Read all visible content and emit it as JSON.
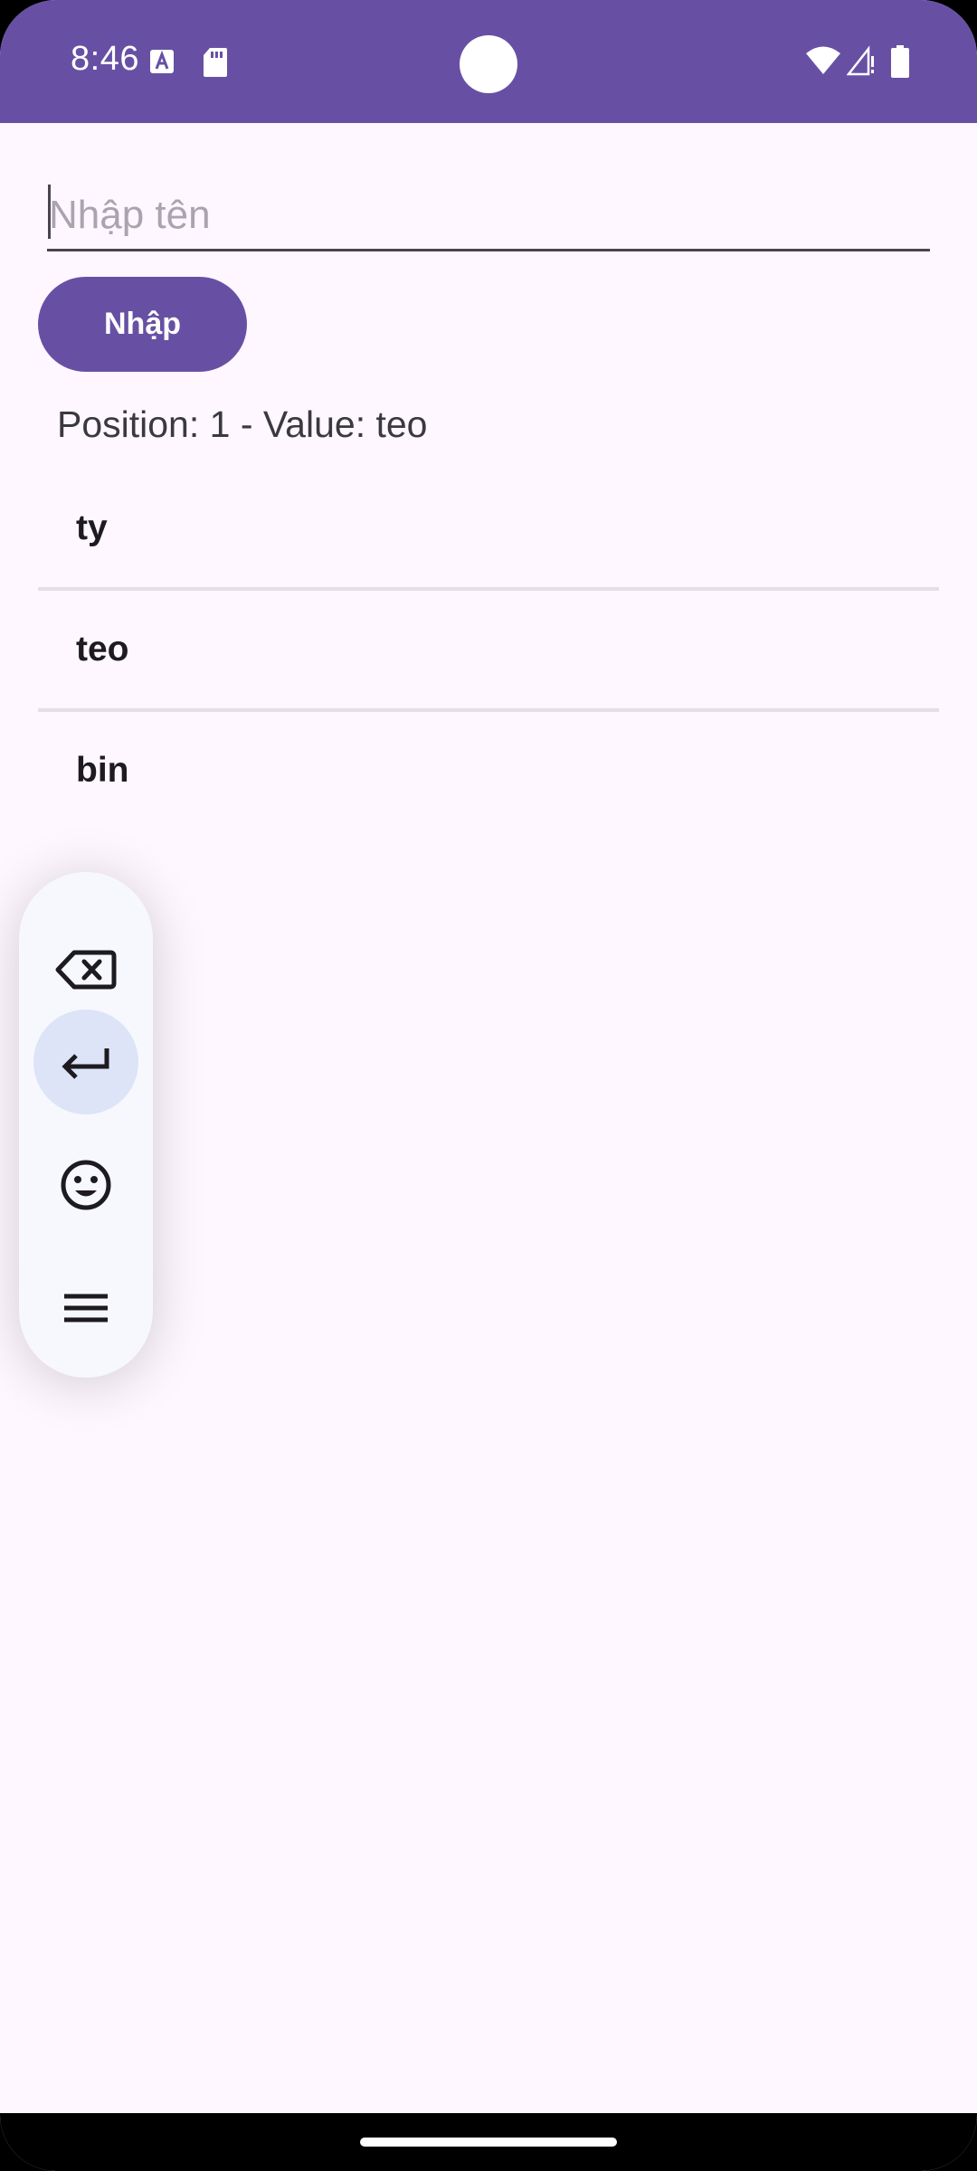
{
  "status_bar": {
    "time": "8:46",
    "icons": [
      "font-a-icon",
      "sd-card-icon",
      "wifi-icon",
      "signal-icon",
      "battery-icon"
    ]
  },
  "form": {
    "input_placeholder": "Nhập tên",
    "input_value": "",
    "submit_label": "Nhập"
  },
  "result": {
    "text": "Position: 1 - Value: teo"
  },
  "list": {
    "items": [
      {
        "label": "ty"
      },
      {
        "label": "teo"
      },
      {
        "label": "bin"
      }
    ]
  },
  "keyboard_toolbar": {
    "buttons": [
      "backspace-icon",
      "enter-icon",
      "emoji-icon",
      "menu-icon"
    ]
  },
  "colors": {
    "primary": "#6750A4",
    "background": "#FEF7FF",
    "toolbar_bg": "#F7F8FD",
    "enter_highlight": "#DDE4F8",
    "divider": "#E4DEE6"
  }
}
